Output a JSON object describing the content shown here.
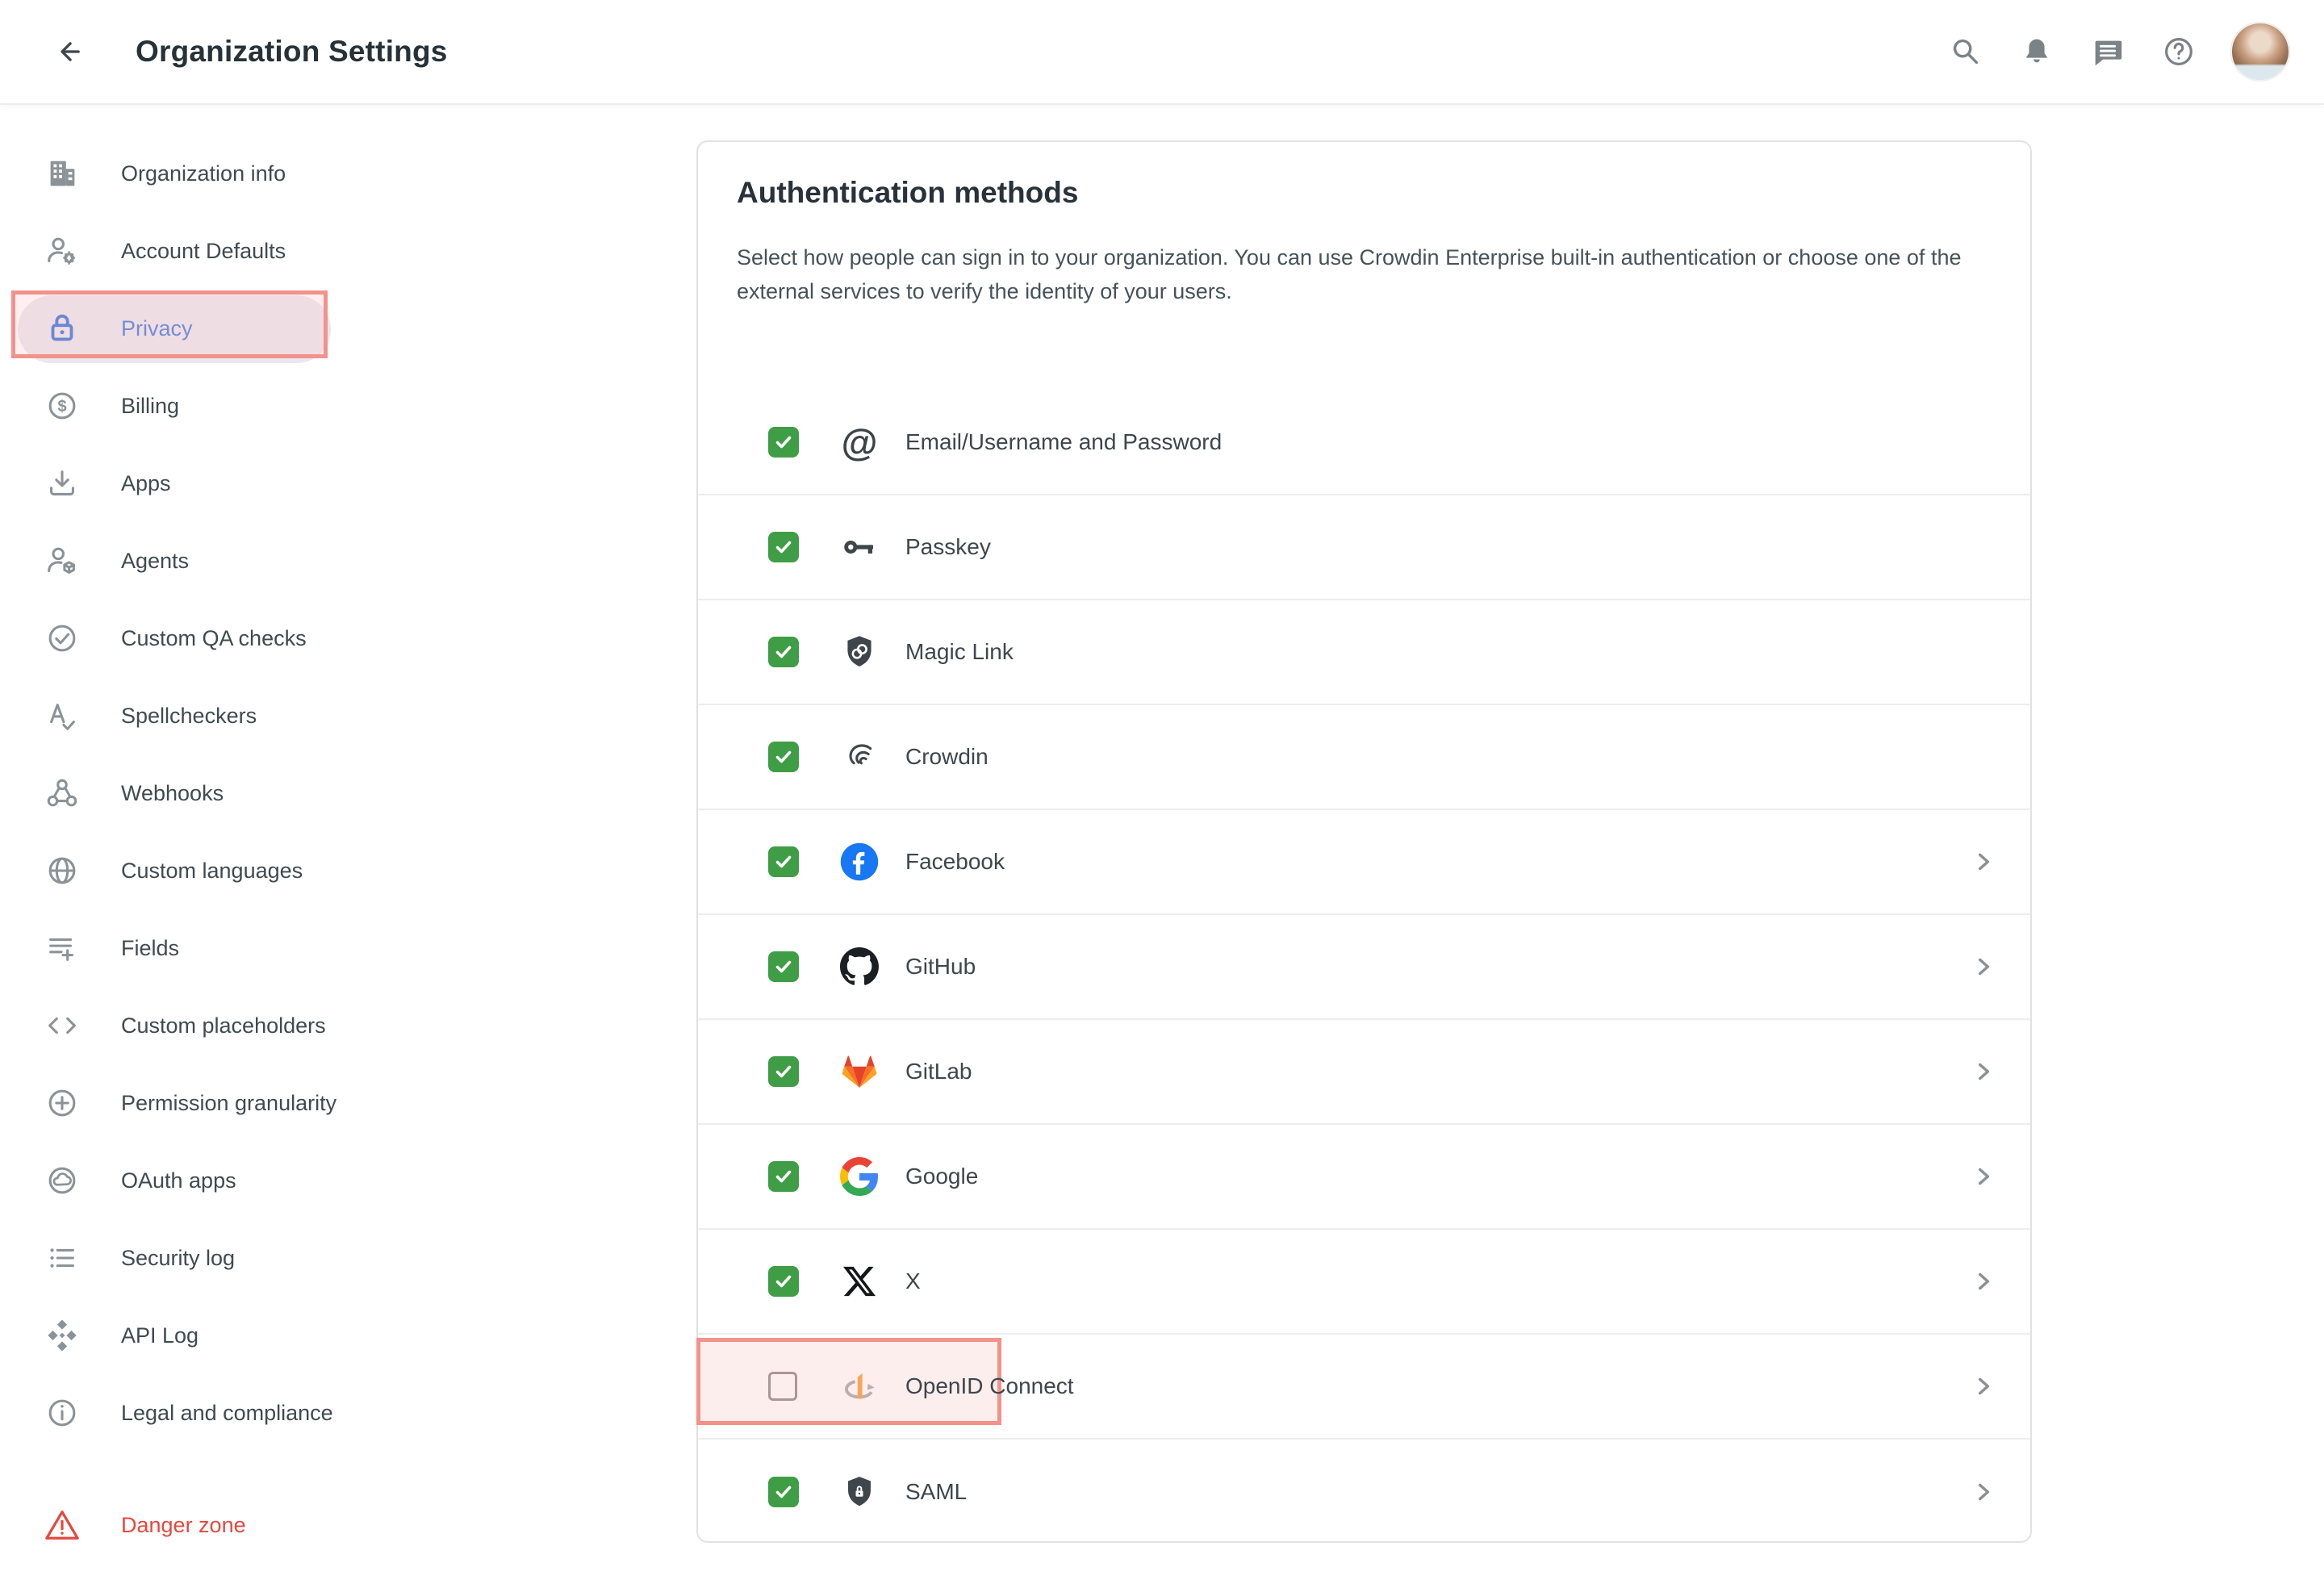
{
  "topbar": {
    "title": "Organization Settings",
    "icons": [
      {
        "name": "search-icon"
      },
      {
        "name": "notifications-icon"
      },
      {
        "name": "messages-icon"
      },
      {
        "name": "help-icon"
      }
    ]
  },
  "sidebar": {
    "items": [
      {
        "label": "Organization info",
        "icon": "building"
      },
      {
        "label": "Account Defaults",
        "icon": "user-gear"
      },
      {
        "label": "Privacy",
        "icon": "lock",
        "active": true,
        "annotated": true
      },
      {
        "label": "Billing",
        "icon": "dollar"
      },
      {
        "label": "Apps",
        "icon": "download"
      },
      {
        "label": "Agents",
        "icon": "user-cube"
      },
      {
        "label": "Custom QA checks",
        "icon": "check-circle"
      },
      {
        "label": "Spellcheckers",
        "icon": "spellcheck"
      },
      {
        "label": "Webhooks",
        "icon": "webhook"
      },
      {
        "label": "Custom languages",
        "icon": "globe"
      },
      {
        "label": "Fields",
        "icon": "fields"
      },
      {
        "label": "Custom placeholders",
        "icon": "code"
      },
      {
        "label": "Permission granularity",
        "icon": "plus-circle"
      },
      {
        "label": "OAuth apps",
        "icon": "cloud-circle"
      },
      {
        "label": "Security log",
        "icon": "list"
      },
      {
        "label": "API Log",
        "icon": "api-diamonds"
      },
      {
        "label": "Legal and compliance",
        "icon": "info-circle"
      },
      {
        "label": "Danger zone",
        "icon": "warning-triangle",
        "danger": true
      }
    ]
  },
  "main": {
    "card": {
      "title": "Authentication methods",
      "description": "Select how people can sign in to your organization. You can use Crowdin Enterprise built-in authentication or choose one of the external services to verify the identity of your users.",
      "methods": [
        {
          "label": "Email/Username and Password",
          "icon": "at",
          "checked": true,
          "chevron": false,
          "highlighted": false
        },
        {
          "label": "Passkey",
          "icon": "key",
          "checked": true,
          "chevron": false,
          "highlighted": false
        },
        {
          "label": "Magic Link",
          "icon": "shield-link",
          "checked": true,
          "chevron": false,
          "highlighted": false
        },
        {
          "label": "Crowdin",
          "icon": "crowdin",
          "checked": true,
          "chevron": false,
          "highlighted": false
        },
        {
          "label": "Facebook",
          "icon": "facebook",
          "checked": true,
          "chevron": true,
          "highlighted": false
        },
        {
          "label": "GitHub",
          "icon": "github",
          "checked": true,
          "chevron": true,
          "highlighted": false
        },
        {
          "label": "GitLab",
          "icon": "gitlab",
          "checked": true,
          "chevron": true,
          "highlighted": false
        },
        {
          "label": "Google",
          "icon": "google",
          "checked": true,
          "chevron": true,
          "highlighted": false
        },
        {
          "label": "X",
          "icon": "x",
          "checked": true,
          "chevron": true,
          "highlighted": false
        },
        {
          "label": "OpenID Connect",
          "icon": "openid",
          "checked": false,
          "chevron": true,
          "highlighted": true
        },
        {
          "label": "SAML",
          "icon": "saml",
          "checked": true,
          "chevron": true,
          "highlighted": false
        }
      ]
    }
  },
  "colors": {
    "accent_blue": "#3b74d8",
    "checkbox_green": "#3f9d45",
    "danger_red": "#e5483f",
    "annotation_border": "#f2928a",
    "annotation_fill": "rgba(249,202,202,0.33)",
    "active_pill": "#ebe6ef",
    "facebook_blue": "#1877f2",
    "gitlab_orange": "#fc6d26",
    "openid_orange": "#f8931e"
  }
}
